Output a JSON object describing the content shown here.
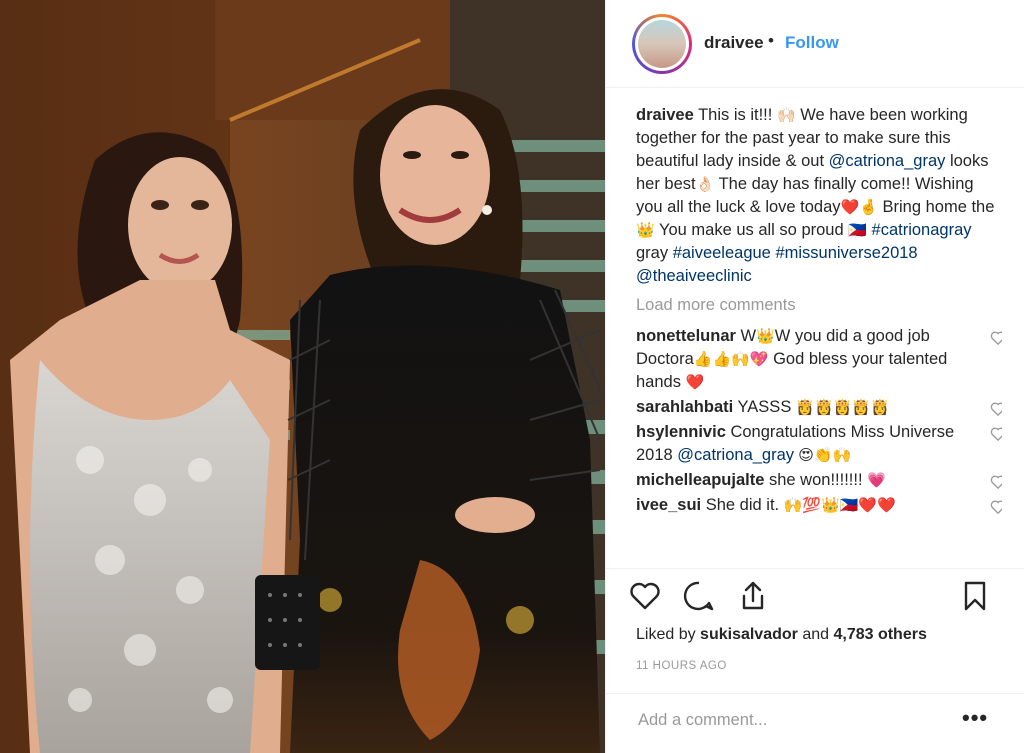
{
  "post": {
    "username": "draivee",
    "separator": "•",
    "follow_label": "Follow",
    "photo_alt": "Two women posing on a staircase"
  },
  "caption": {
    "username": "draivee",
    "t1": " This is it!!! ",
    "e1": "🙌🏻",
    "t2": " We have been working together for the past year to make sure this beautiful lady inside & out ",
    "mention": "@catriona_gray",
    "t3": " looks her best",
    "e2": "👌🏻",
    "t4": " The day has finally come!! Wishing you all the luck & love today",
    "e3": "❤️🤞",
    "t5": " Bring home the ",
    "e4": "👑",
    "t6": " You make us all so proud ",
    "e5": "🇵🇭",
    "tag1": "#catrionagray",
    "t7": " gray ",
    "tag2": "#aiveeleague",
    "tag3": "#missuniverse2018",
    "tag4": "@theaiveeclinic"
  },
  "load_more": "Load more comments",
  "comments": [
    {
      "user": "nonettelunar",
      "text": "W",
      "e1": "👑",
      "text2": "W you did a good job Doctora",
      "e2": "👍👍🙌💖",
      "text3": " God bless your talented hands ",
      "e3": "❤️"
    },
    {
      "user": "sarahlahbati",
      "text": "YASSS ",
      "e1": "👸👸👸👸👸"
    },
    {
      "user": "hsylennivic",
      "text": "Congratulations Miss Universe 2018 ",
      "mention": "@catriona_gray",
      "e1": " 😍👏🙌"
    },
    {
      "user": "michelleapujalte",
      "text": "she won!!!!!!! ",
      "e1": "💗"
    },
    {
      "user": "ivee_sui",
      "text": "She did it. ",
      "e1": "🙌💯👑🇵🇭❤️❤️"
    }
  ],
  "likes": {
    "prefix": "Liked by ",
    "user": "sukisalvador",
    "mid": " and ",
    "count": "4,783 others"
  },
  "timestamp": "11 HOURS AGO",
  "add_comment": {
    "placeholder": "Add a comment..."
  },
  "more_label": "•••",
  "icons": [
    "like-icon",
    "comment-icon",
    "share-icon",
    "bookmark-icon",
    "heart-outline-icon"
  ],
  "colors": {
    "link": "#003569",
    "follow": "#3897f0",
    "muted": "#999999"
  }
}
